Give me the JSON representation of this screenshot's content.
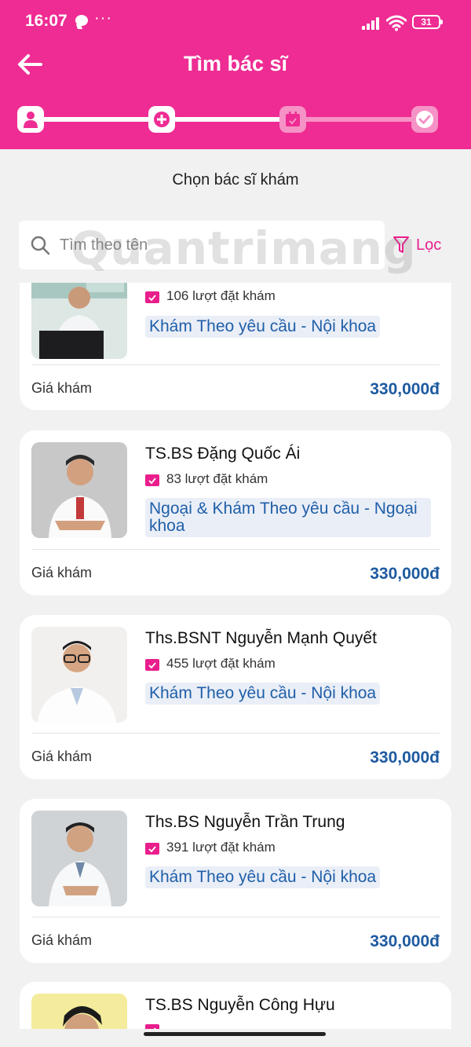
{
  "status_bar": {
    "time": "16:07",
    "dots": "···",
    "battery": "31"
  },
  "header": {
    "title": "Tìm bác sĩ"
  },
  "steps": [
    "person-icon",
    "medical-cross-icon",
    "calendar-icon",
    "checkmark-icon"
  ],
  "page": {
    "subtitle": "Chọn bác sĩ khám"
  },
  "search": {
    "placeholder": "Tìm theo tên",
    "value": "",
    "filter_label": "Lọc"
  },
  "watermark": "Quantrimang",
  "doctors": [
    {
      "name": "",
      "bookings": "106 lượt đặt khám",
      "specialty": "Khám Theo yêu cầu - Nội khoa",
      "fee_label": "Giá khám",
      "fee": "330,000đ"
    },
    {
      "name": "TS.BS Đặng Quốc Ái",
      "bookings": "83 lượt đặt khám",
      "specialty": "Ngoại &  Khám Theo yêu cầu - Ngoại khoa",
      "fee_label": "Giá khám",
      "fee": "330,000đ"
    },
    {
      "name": "Ths.BSNT Nguyễn Mạnh Quyết",
      "bookings": "455 lượt đặt khám",
      "specialty": "Khám Theo yêu cầu - Nội khoa",
      "fee_label": "Giá khám",
      "fee": "330,000đ"
    },
    {
      "name": "Ths.BS Nguyễn Trần Trung",
      "bookings": "391 lượt đặt khám",
      "specialty": "Khám Theo yêu cầu - Nội khoa",
      "fee_label": "Giá khám",
      "fee": "330,000đ"
    },
    {
      "name": "TS.BS Nguyễn Công Hựu",
      "bookings": "",
      "specialty": "",
      "fee_label": "",
      "fee": ""
    }
  ],
  "colors": {
    "brand": "#ee2c93",
    "price": "#1e5aa0",
    "tag_bg": "#eaeef7",
    "tag_text": "#1f5fa8"
  }
}
